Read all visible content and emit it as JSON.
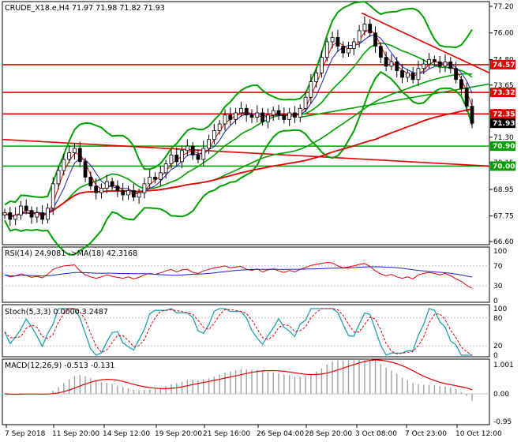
{
  "header": {
    "price": "CRUDE_X18.e,H4  71.97 71.98 71.82 71.93",
    "rsi": "RSI(14) 24.9081  ->MA(18) 42.3168",
    "stoch": "Stoch(5,3,3) 0.0000 3.2487",
    "macd": "MACD(12,26,9) -0.513 -0.131"
  },
  "chart_data": {
    "type": "candlestick",
    "symbol": "CRUDE_X18.e",
    "timeframe": "H4",
    "ohlc_last": {
      "open": 71.97,
      "high": 71.98,
      "low": 71.82,
      "close": 71.93
    },
    "price_axis": {
      "range": [
        66.4,
        77.4
      ],
      "ticks": [
        "77.20",
        "76.00",
        "74.80",
        "73.65",
        "72.45",
        "71.30",
        "70.15",
        "68.95",
        "67.75",
        "66.60"
      ]
    },
    "time_axis": [
      "7 Sep 2018",
      "11 Sep 20:00",
      "14 Sep 12:00",
      "19 Sep 20:00",
      "21 Sep 16:00",
      "26 Sep 04:00",
      "28 Sep 20:00",
      "3 Oct 08:00",
      "7 Oct 23:00",
      "10 Oct 12:00"
    ],
    "closes": [
      67.9,
      67.6,
      67.8,
      68.2,
      68.0,
      67.7,
      67.9,
      67.6,
      68.1,
      69.2,
      69.8,
      70.3,
      70.6,
      70.8,
      70.2,
      69.5,
      69.1,
      68.8,
      69.0,
      69.3,
      69.1,
      68.9,
      68.7,
      68.9,
      68.6,
      68.8,
      69.2,
      69.5,
      69.4,
      69.7,
      70.1,
      70.5,
      70.2,
      70.7,
      70.9,
      70.5,
      70.3,
      70.8,
      71.2,
      71.6,
      71.9,
      72.3,
      72.1,
      72.4,
      72.6,
      72.3,
      72.2,
      72.4,
      72.0,
      72.3,
      72.5,
      72.3,
      72.1,
      72.4,
      72.2,
      72.6,
      73.1,
      73.8,
      74.2,
      74.9,
      75.6,
      75.8,
      75.4,
      75.1,
      75.3,
      75.6,
      76.1,
      76.4,
      76.0,
      75.4,
      74.9,
      74.5,
      74.7,
      74.3,
      74.0,
      74.2,
      73.9,
      74.4,
      74.6,
      74.8,
      74.7,
      74.5,
      74.7,
      74.4,
      73.9,
      73.5,
      72.7,
      71.93
    ],
    "horizontal_levels": [
      {
        "value": 74.57,
        "label": "74.57",
        "color": "#e30000"
      },
      {
        "value": 73.32,
        "label": "73.32",
        "color": "#e30000"
      },
      {
        "value": 72.35,
        "label": "72.35",
        "color": "#e30000"
      },
      {
        "value": 70.9,
        "label": "70.90",
        "color": "#00a000"
      },
      {
        "value": 70.0,
        "label": "70.00",
        "color": "#00a000"
      }
    ],
    "current_price": {
      "value": 71.93,
      "label": "71.93"
    },
    "indicators": {
      "rsi": {
        "period": 14,
        "ma_period": 18,
        "value": 24.9081,
        "ma": 42.3168,
        "ticks": [
          "100",
          "70",
          "30",
          "0"
        ],
        "values": [
          52,
          48,
          50,
          54,
          51,
          47,
          49,
          46,
          53,
          63,
          67,
          70,
          71,
          72,
          60,
          52,
          48,
          45,
          48,
          52,
          49,
          47,
          45,
          48,
          44,
          47,
          52,
          55,
          53,
          56,
          60,
          63,
          58,
          62,
          63,
          57,
          55,
          60,
          63,
          66,
          68,
          70,
          66,
          68,
          69,
          63,
          61,
          64,
          58,
          62,
          64,
          60,
          57,
          61,
          58,
          63,
          67,
          71,
          73,
          75,
          77,
          76,
          70,
          66,
          68,
          70,
          73,
          75,
          69,
          60,
          54,
          50,
          53,
          48,
          45,
          48,
          44,
          52,
          55,
          57,
          55,
          52,
          55,
          50,
          44,
          39,
          31,
          25
        ]
      },
      "stochastic": {
        "params": "5,3,3",
        "k": 0.0,
        "d": 3.2487,
        "ticks": [
          "100",
          "80",
          "20",
          "0"
        ]
      },
      "macd": {
        "params": "12,26,9",
        "macd": -0.513,
        "signal": -0.131,
        "ticks": [
          "1.001",
          "0.00",
          "-0.95"
        ]
      }
    }
  }
}
